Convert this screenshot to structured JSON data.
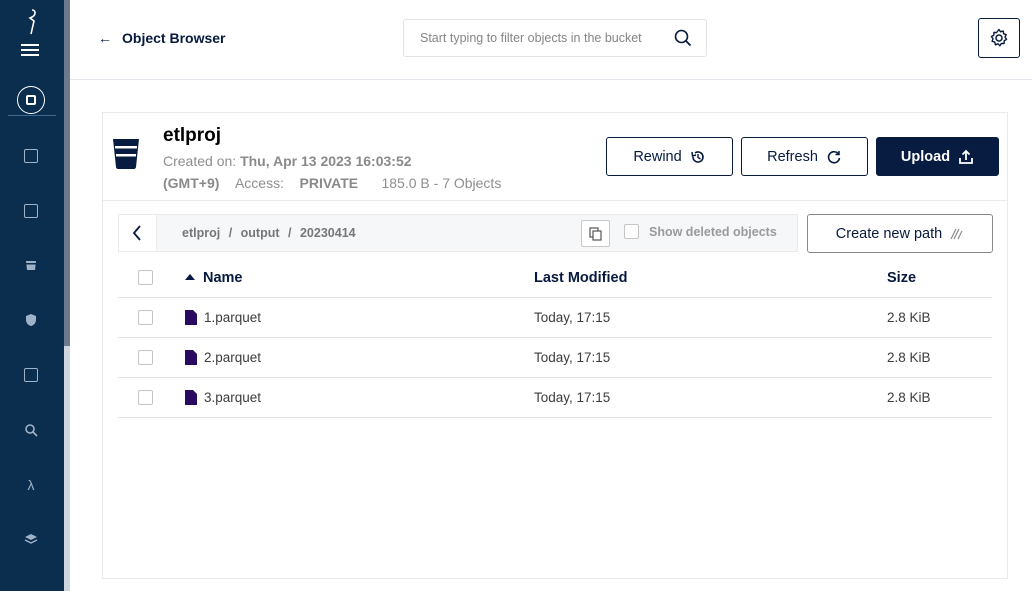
{
  "colors": {
    "sidebar": "#0b2d4e",
    "primary": "#081c42",
    "file_icon": "#2a0a5e"
  },
  "header": {
    "back_label": "Object Browser",
    "search_placeholder": "Start typing to filter objects in the bucket"
  },
  "sidebar": {
    "icons": [
      "minio-logo",
      "menu-icon",
      "object-browser-icon",
      "identity-icon",
      "documents-icon",
      "buckets-icon",
      "policy-icon",
      "access-icon",
      "monitoring-icon",
      "lambda-icon",
      "tiers-icon"
    ]
  },
  "bucket": {
    "name": "etlproj",
    "created_label": "Created on:",
    "created_value": "Thu, Apr 13 2023 16:03:52",
    "timezone": "(GMT+9)",
    "access_label": "Access:",
    "access_value": "PRIVATE",
    "usage": "185.0 B - 7 Objects"
  },
  "actions": {
    "rewind": "Rewind",
    "refresh": "Refresh",
    "upload": "Upload",
    "create_path": "Create new path"
  },
  "path": {
    "crumbs": [
      "etlproj",
      "output",
      "20230414"
    ],
    "separator": "/",
    "show_deleted": "Show deleted objects"
  },
  "table": {
    "columns": {
      "name": "Name",
      "modified": "Last Modified",
      "size": "Size"
    },
    "rows": [
      {
        "name": "1.parquet",
        "modified": "Today, 17:15",
        "size": "2.8 KiB"
      },
      {
        "name": "2.parquet",
        "modified": "Today, 17:15",
        "size": "2.8 KiB"
      },
      {
        "name": "3.parquet",
        "modified": "Today, 17:15",
        "size": "2.8 KiB"
      }
    ]
  }
}
